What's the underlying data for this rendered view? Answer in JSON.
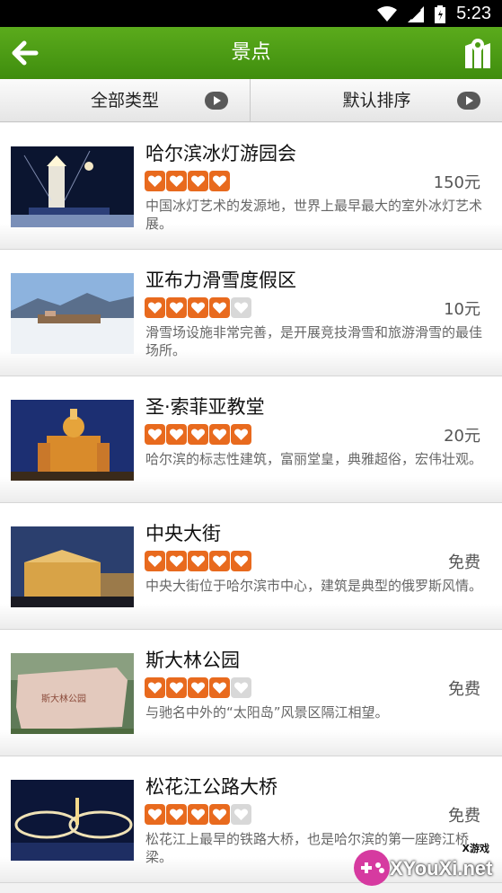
{
  "status_bar": {
    "time": "5:23",
    "icons": [
      "wifi-icon",
      "signal-icon",
      "battery-icon"
    ]
  },
  "app_bar": {
    "title": "景点",
    "back_icon": "arrow-left-icon",
    "map_icon": "map-icon"
  },
  "filters": [
    {
      "label": "全部类型",
      "icon": "play-arrow-icon"
    },
    {
      "label": "默认排序",
      "icon": "play-arrow-icon"
    }
  ],
  "colors": {
    "green": "#4a9c14",
    "heart": "#e86a1e",
    "empty_heart": "#d8d8d8"
  },
  "attractions": [
    {
      "name": "哈尔滨冰灯游园会",
      "rating": 4,
      "max_rating": 4,
      "price": "150元",
      "description": "中国冰灯艺术的发源地，世界上最早最大的室外冰灯艺术展。"
    },
    {
      "name": "亚布力滑雪度假区",
      "rating": 4,
      "max_rating": 5,
      "price": "10元",
      "description": "滑雪场设施非常完善，是开展竞技滑雪和旅游滑雪的最佳场所。"
    },
    {
      "name": "圣·索菲亚教堂",
      "rating": 5,
      "max_rating": 5,
      "price": "20元",
      "description": "哈尔滨的标志性建筑，富丽堂皇，典雅超俗，宏伟壮观。"
    },
    {
      "name": "中央大街",
      "rating": 5,
      "max_rating": 5,
      "price": "免费",
      "description": "中央大街位于哈尔滨市中心，建筑是典型的俄罗斯风情。"
    },
    {
      "name": "斯大林公园",
      "rating": 4,
      "max_rating": 5,
      "price": "免费",
      "description": "与驰名中外的“太阳岛”风景区隔江相望。"
    },
    {
      "name": "松花江公路大桥",
      "rating": 4,
      "max_rating": 5,
      "price": "免费",
      "description": "松花江上最早的铁路大桥，也是哈尔滨的第一座跨江桥梁。"
    }
  ],
  "watermark": {
    "tag": "X游戏",
    "text": "XYouXi.net"
  }
}
